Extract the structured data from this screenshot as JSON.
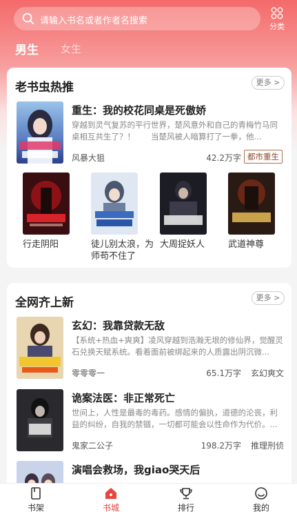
{
  "colors": {
    "accent": "#e8453c",
    "header_top": "#f46a6a",
    "tag_border": "#b56a4a"
  },
  "search": {
    "placeholder": "请输入书名或者作者名搜索",
    "category_label": "分类"
  },
  "gender_tabs": [
    {
      "label": "男生",
      "active": true
    },
    {
      "label": "女生",
      "active": false
    }
  ],
  "section_hot": {
    "title": "老书虫热推",
    "more_label": "更多 >",
    "featured": {
      "title": "重生：我的校花同桌是死傲娇",
      "desc": "穿越到灵气复苏的平行世界，楚风意外和自己的青梅竹马同桌相互共生了？！　　当楚风被人暗算打了一拳，他...",
      "author": "风暴大狙",
      "words": "42.2万字",
      "tag": "都市重生"
    },
    "grid": [
      {
        "name": "行走阴阳"
      },
      {
        "name": "徒儿别太浪，为师苟不住了"
      },
      {
        "name": "大周捉妖人"
      },
      {
        "name": "武道神尊"
      }
    ]
  },
  "section_new": {
    "title": "全网齐上新",
    "more_label": "更多 >",
    "books": [
      {
        "title": "玄幻：我靠贷款无敌",
        "desc": "【系统+热血+爽爽】凌风穿越到浩瀚无垠的修仙界，觉醒灵石兑换天赋系统。看着面前被绑起来的人质露出阴沉微...",
        "author": "零零零一",
        "words": "65.1万字",
        "tag": "玄幻爽文"
      },
      {
        "title": "诡案法医：非正常死亡",
        "desc": "世间上，人性是最毒的毒药。感情的偏执，道德的沦丧，利益的纠纷，自我的禁锢，一切都可能会以性命作为代价。...",
        "author": "鬼家二公子",
        "words": "198.2万字",
        "tag": "推理刑侦"
      },
      {
        "title": "演唱会救场，我giao哭天后",
        "desc": "",
        "author": "",
        "words": "",
        "tag": ""
      }
    ]
  },
  "tabbar": [
    {
      "label": "书架",
      "icon": "bookshelf-icon",
      "active": false
    },
    {
      "label": "书城",
      "icon": "bookstore-icon",
      "active": true
    },
    {
      "label": "排行",
      "icon": "trophy-icon",
      "active": false
    },
    {
      "label": "我的",
      "icon": "profile-icon",
      "active": false
    }
  ]
}
